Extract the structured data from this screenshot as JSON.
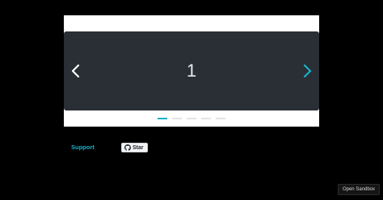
{
  "carousel": {
    "current_slide_label": "1",
    "prev_arrow_color": "#ffffff",
    "next_arrow_color": "#17b2c8",
    "dots_total": 5,
    "active_dot_index": 0,
    "accent_color": "#17b2c8"
  },
  "footer": {
    "support_label": "Support",
    "star_label": "Star",
    "star_icon": "github-icon"
  },
  "sandbox": {
    "open_label": "Open Sandbox"
  }
}
